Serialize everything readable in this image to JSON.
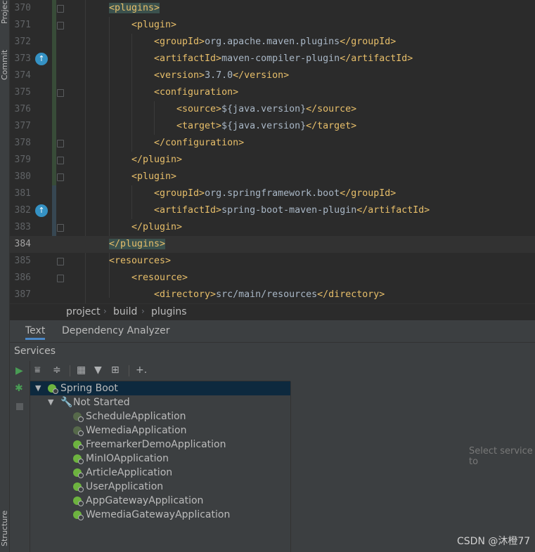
{
  "side_tabs": {
    "project": "Project",
    "commit": "Commit",
    "structure": "Structure"
  },
  "editor": {
    "lines": [
      {
        "n": "370",
        "parts": [
          [
            "tag-hl",
            "<plugins>"
          ]
        ]
      },
      {
        "n": "371",
        "parts": [
          [
            "tag",
            "<plugin>"
          ]
        ]
      },
      {
        "n": "372",
        "parts": [
          [
            "tag",
            "<groupId>"
          ],
          [
            "txt",
            "org.apache.maven.plugins"
          ],
          [
            "tag",
            "</groupId>"
          ]
        ]
      },
      {
        "n": "373",
        "parts": [
          [
            "tag",
            "<artifactId>"
          ],
          [
            "txt",
            "maven-compiler-plugin"
          ],
          [
            "tag",
            "</artifactId>"
          ]
        ]
      },
      {
        "n": "374",
        "parts": [
          [
            "tag",
            "<version>"
          ],
          [
            "txt",
            "3.7.0"
          ],
          [
            "tag",
            "</version>"
          ]
        ]
      },
      {
        "n": "375",
        "parts": [
          [
            "tag",
            "<configuration>"
          ]
        ]
      },
      {
        "n": "376",
        "parts": [
          [
            "tag",
            "<source>"
          ],
          [
            "txt",
            "${java.version}"
          ],
          [
            "tag",
            "</source>"
          ]
        ]
      },
      {
        "n": "377",
        "parts": [
          [
            "tag",
            "<target>"
          ],
          [
            "txt",
            "${java.version}"
          ],
          [
            "tag",
            "</target>"
          ]
        ]
      },
      {
        "n": "378",
        "parts": [
          [
            "tag",
            "</configuration>"
          ]
        ]
      },
      {
        "n": "379",
        "parts": [
          [
            "tag",
            "</plugin>"
          ]
        ]
      },
      {
        "n": "380",
        "parts": [
          [
            "tag",
            "<plugin>"
          ]
        ]
      },
      {
        "n": "381",
        "parts": [
          [
            "tag",
            "<groupId>"
          ],
          [
            "txt",
            "org.springframework.boot"
          ],
          [
            "tag",
            "</groupId>"
          ]
        ]
      },
      {
        "n": "382",
        "parts": [
          [
            "tag",
            "<artifactId>"
          ],
          [
            "txt",
            "spring-boot-maven-plugin"
          ],
          [
            "tag",
            "</artifactId>"
          ]
        ]
      },
      {
        "n": "383",
        "parts": [
          [
            "tag",
            "</plugin>"
          ]
        ]
      },
      {
        "n": "384",
        "parts": [
          [
            "tag-hl",
            "</plugins>"
          ]
        ]
      },
      {
        "n": "385",
        "parts": [
          [
            "tag",
            "<resources>"
          ]
        ]
      },
      {
        "n": "386",
        "parts": [
          [
            "tag",
            "<resource>"
          ]
        ]
      },
      {
        "n": "387",
        "parts": [
          [
            "tag",
            "<directory>"
          ],
          [
            "txt",
            "src/main/resources"
          ],
          [
            "tag",
            "</directory>"
          ]
        ]
      }
    ]
  },
  "breadcrumb": [
    "project",
    "build",
    "plugins"
  ],
  "subtabs": {
    "text": "Text",
    "dependency_analyzer": "Dependency Analyzer"
  },
  "services": {
    "title": "Services",
    "root": "Spring Boot",
    "group": "Not Started",
    "apps": [
      {
        "name": "ScheduleApplication",
        "icon": "spring-gray-icon"
      },
      {
        "name": "WemediaApplication",
        "icon": "spring-gray-icon"
      },
      {
        "name": "FreemarkerDemoApplication",
        "icon": "spring-boot-icon"
      },
      {
        "name": "MinIOApplication",
        "icon": "spring-boot-icon"
      },
      {
        "name": "ArticleApplication",
        "icon": "spring-boot-icon"
      },
      {
        "name": "UserApplication",
        "icon": "spring-boot-icon"
      },
      {
        "name": "AppGatewayApplication",
        "icon": "spring-boot-icon"
      },
      {
        "name": "WemediaGatewayApplication",
        "icon": "spring-boot-icon"
      }
    ],
    "detail_placeholder": "Select service to"
  },
  "watermark": "CSDN @沐橙77",
  "colors": {
    "tag": "#e8bf6a",
    "text": "#a9b7c6",
    "accent": "#4a88c7",
    "spring_green": "#6db33f",
    "run_green": "#499c54"
  }
}
